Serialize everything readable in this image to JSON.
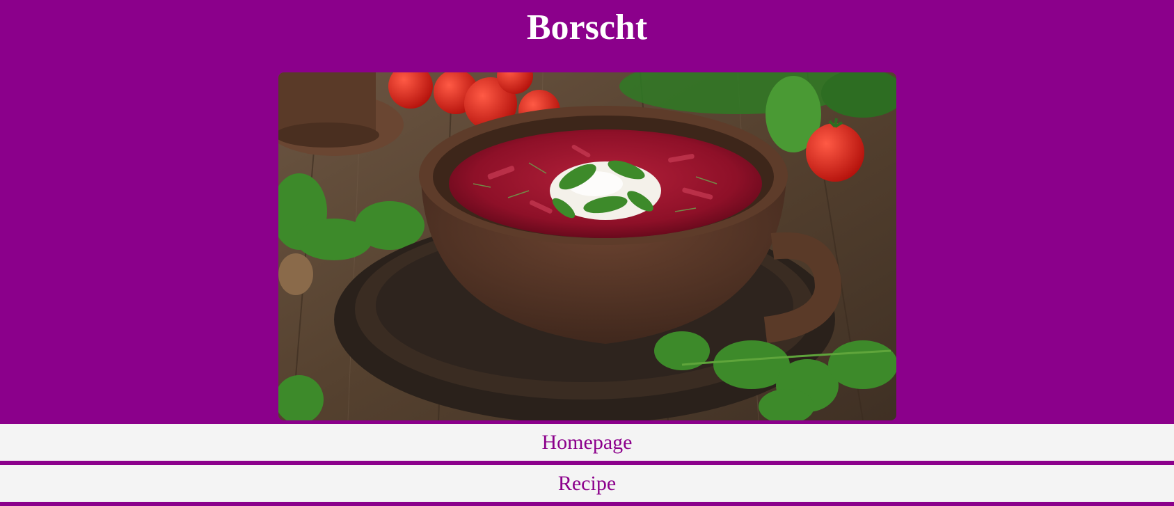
{
  "page": {
    "title": "Borscht"
  },
  "hero_image": {
    "alt": "Bowl of borscht with sour cream and herbs on a wooden table",
    "colors": {
      "background_wood": "#5a4634",
      "soup": "#8e1028",
      "bowl": "#4a3022",
      "plate": "#2e241e",
      "sour_cream": "#f4f1ea",
      "herb": "#3d8a2a",
      "tomato": "#d81c14"
    }
  },
  "nav": {
    "items": [
      {
        "label": "Homepage"
      },
      {
        "label": "Recipe"
      }
    ]
  },
  "colors": {
    "page_background": "#8b008b",
    "title_text": "#ffffff",
    "nav_background": "#f4f4f4",
    "nav_text": "#8b008b"
  }
}
